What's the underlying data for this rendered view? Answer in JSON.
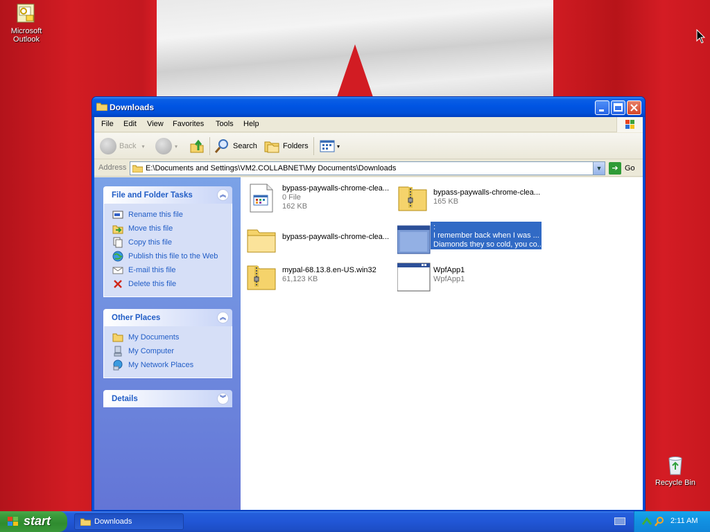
{
  "desktop": {
    "icons": [
      {
        "label_line1": "Microsoft",
        "label_line2": "Outlook"
      },
      {
        "label": "Recycle Bin"
      }
    ]
  },
  "window": {
    "title": "Downloads",
    "menu": [
      "File",
      "Edit",
      "View",
      "Favorites",
      "Tools",
      "Help"
    ],
    "toolbar": {
      "back": "Back",
      "search": "Search",
      "folders": "Folders"
    },
    "address": {
      "label": "Address",
      "path": "E:\\Documents and Settings\\VM2.COLLABNET\\My Documents\\Downloads",
      "go": "Go"
    },
    "tasks_panel": {
      "title": "File and Folder Tasks",
      "links": [
        "Rename this file",
        "Move this file",
        "Copy this file",
        "Publish this file to the Web",
        "E-mail this file",
        "Delete this file"
      ]
    },
    "places_panel": {
      "title": "Other Places",
      "links": [
        "My Documents",
        "My Computer",
        "My Network Places"
      ]
    },
    "details_panel": {
      "title": "Details"
    },
    "files": [
      {
        "name": "bypass-paywalls-chrome-clea...",
        "line2": "0 File",
        "line3": "162 KB",
        "icon": "generic-file-icon"
      },
      {
        "name": "bypass-paywalls-chrome-clea...",
        "line2": "165 KB",
        "icon": "zip-folder-icon"
      },
      {
        "name": "bypass-paywalls-chrome-clea...",
        "icon": "folder-icon"
      },
      {
        "name": ":",
        "line2": "I remember back when I was ...",
        "line3": "Diamonds they so cold, you co...",
        "icon": "app-window-icon",
        "selected": true
      },
      {
        "name": "mypal-68.13.8.en-US.win32",
        "line2": "61,123 KB",
        "icon": "zip-folder-icon"
      },
      {
        "name": "WpfApp1",
        "line2": "WpfApp1",
        "icon": "app-window-icon"
      }
    ]
  },
  "taskbar": {
    "start": "start",
    "task": "Downloads",
    "clock": "2:11 AM"
  }
}
